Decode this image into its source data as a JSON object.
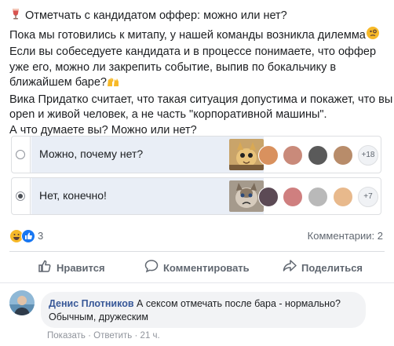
{
  "post": {
    "lines": [
      "Отметчать с кандидатом оффер: можно или нет?",
      "Пока мы готовились к митапу, у нашей команды возникла дилемма",
      "Если вы собеседуете кандидата и в процессе понимаете, что оффер",
      "уже его, можно ли закрепить событие, выпив по бокальчику в",
      "ближайшем баре?",
      "Вика Придатко считает, что такая ситуация допустима и покажет, что вы",
      "open и живой человек, а не часть \"корпоративной машины\".",
      "А что думаете вы? Можно или нет?"
    ]
  },
  "poll": {
    "options": [
      {
        "label": "Можно, почему нет?",
        "selected": false,
        "more": "+18",
        "thumb_icon": "cat-meme"
      },
      {
        "label": "Нет, конечно!",
        "selected": true,
        "more": "+7",
        "thumb_icon": "grumpy-cat-meme"
      }
    ]
  },
  "reactions": {
    "count": "3",
    "icons": [
      "haha",
      "like"
    ]
  },
  "comments_count": "Комментарии: 2",
  "actions": {
    "like": "Нравится",
    "comment": "Комментировать",
    "share": "Поделиться"
  },
  "comment": {
    "author": "Денис Плотников",
    "text_line1": "А сексом отмечать после бара - нормально?",
    "text_line2": "Обычным, дружеским",
    "show": "Показать",
    "dot": "·",
    "reply": "Ответить",
    "time": "21 ч."
  },
  "colors": {
    "link_blue": "#385898",
    "like_blue": "#1877f2",
    "haha_yellow": "#f7b928",
    "poll_fill": "#e9eef6"
  }
}
